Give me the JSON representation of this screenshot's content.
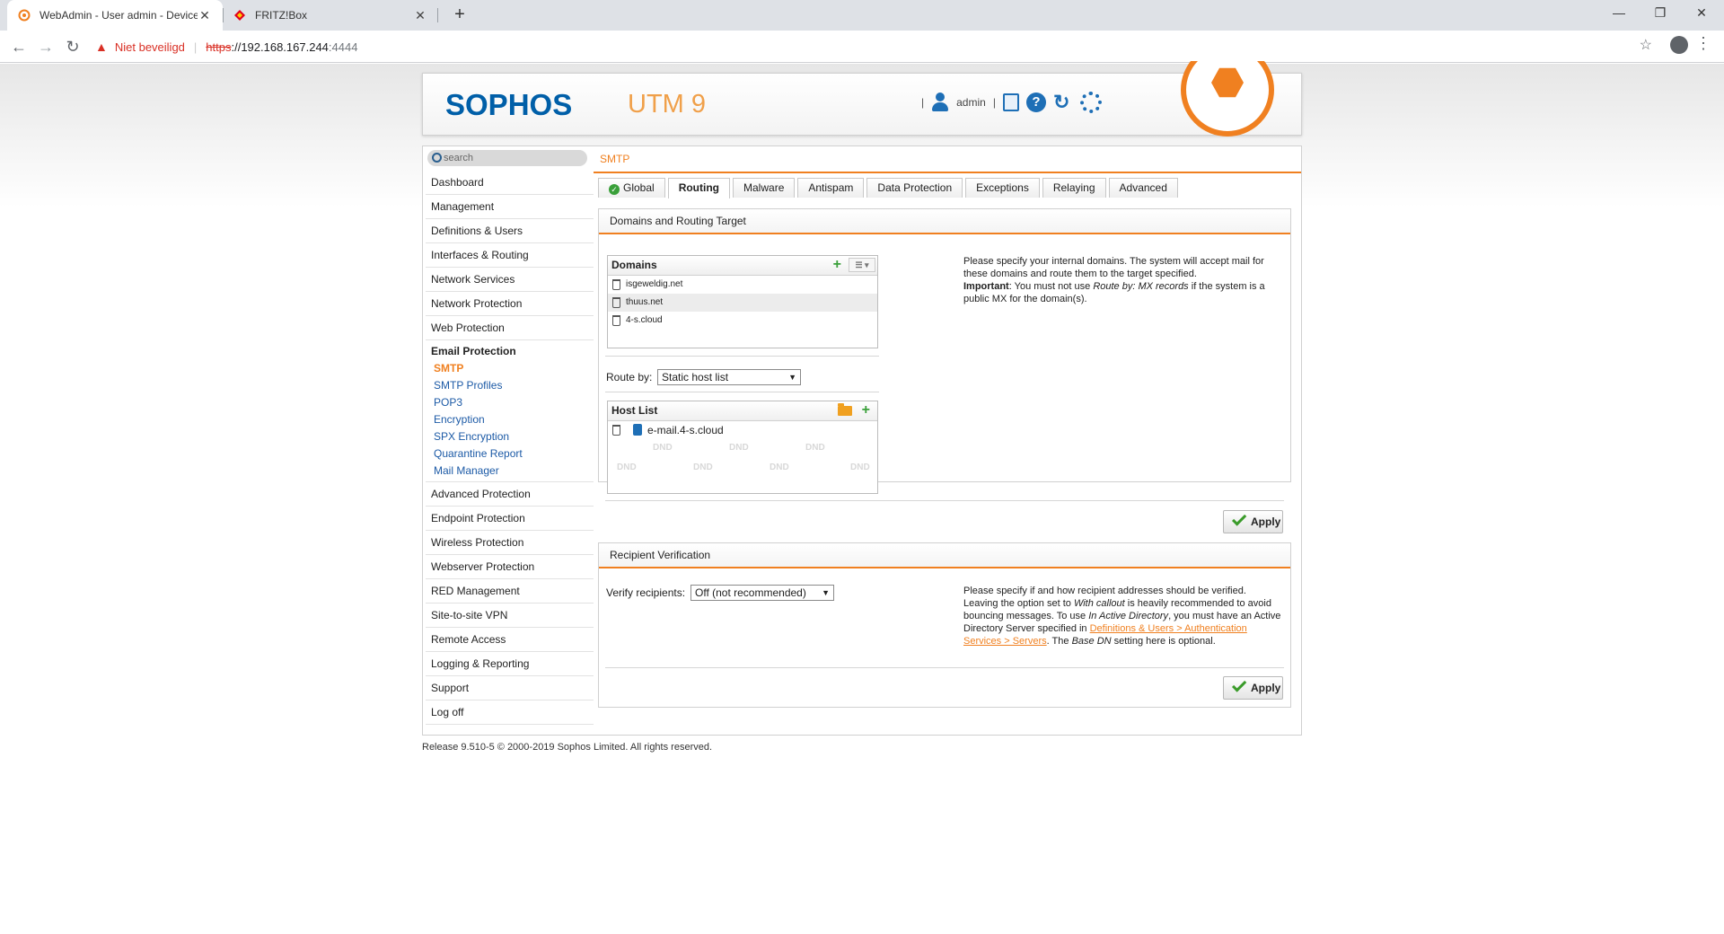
{
  "browser": {
    "tabs": [
      {
        "title": "WebAdmin - User admin - Device",
        "active": true
      },
      {
        "title": "FRITZ!Box",
        "active": false
      }
    ],
    "security_label": "Niet beveiligd",
    "url_scheme": "https",
    "url_host": "://192.168.167.244",
    "url_port": ":4444"
  },
  "header": {
    "logo": "SOPHOS",
    "product": "UTM 9",
    "user": "admin"
  },
  "search": {
    "placeholder": "search"
  },
  "breadcrumb": "SMTP",
  "sidebar": {
    "items": [
      "Dashboard",
      "Management",
      "Definitions & Users",
      "Interfaces & Routing",
      "Network Services",
      "Network Protection",
      "Web Protection"
    ],
    "open_item": "Email Protection",
    "subitems": [
      "SMTP",
      "SMTP Profiles",
      "POP3",
      "Encryption",
      "SPX Encryption",
      "Quarantine Report",
      "Mail Manager"
    ],
    "items_after": [
      "Advanced Protection",
      "Endpoint Protection",
      "Wireless Protection",
      "Webserver Protection",
      "RED Management",
      "Site-to-site VPN",
      "Remote Access",
      "Logging & Reporting",
      "Support",
      "Log off"
    ]
  },
  "tabs": [
    "Global",
    "Routing",
    "Malware",
    "Antispam",
    "Data Protection",
    "Exceptions",
    "Relaying",
    "Advanced"
  ],
  "domains_section": {
    "title": "Domains and Routing Target",
    "domains_header": "Domains",
    "domains": [
      "isgeweldig.net",
      "thuus.net",
      "4-s.cloud"
    ],
    "route_by_label": "Route by:",
    "route_by_value": "Static host list",
    "host_list_header": "Host List",
    "hosts": [
      "e-mail.4-s.cloud"
    ],
    "dnd_label": "DND",
    "help_1": "Please specify your internal domains. The system will accept mail for these domains and route them to the target specified.",
    "help_important": "Important",
    "help_2": ": You must not use ",
    "help_em": "Route by: MX records",
    "help_3": " if the system is a public MX for the domain(s).",
    "apply": "Apply"
  },
  "recipient_section": {
    "title": "Recipient Verification",
    "verify_label": "Verify recipients:",
    "verify_value": "Off (not recommended)",
    "help_1": "Please specify if and how recipient addresses should be verified. Leaving the option set to ",
    "help_em1": "With callout",
    "help_2": " is heavily recommended to avoid bouncing messages. To use ",
    "help_em2": "In Active Directory",
    "help_3": ", you must have an Active Directory Server specified in ",
    "help_link": "Definitions & Users > Authentication Services > Servers",
    "help_4": ". The ",
    "help_em3": "Base DN",
    "help_5": " setting here is optional.",
    "apply": "Apply"
  },
  "footer": "Release 9.510-5  © 2000-2019 Sophos Limited. All rights reserved.",
  "colors": {
    "accent": "#f08020",
    "brand": "#005fa8",
    "link": "#1c5aa6",
    "ok": "#3aa03a"
  }
}
